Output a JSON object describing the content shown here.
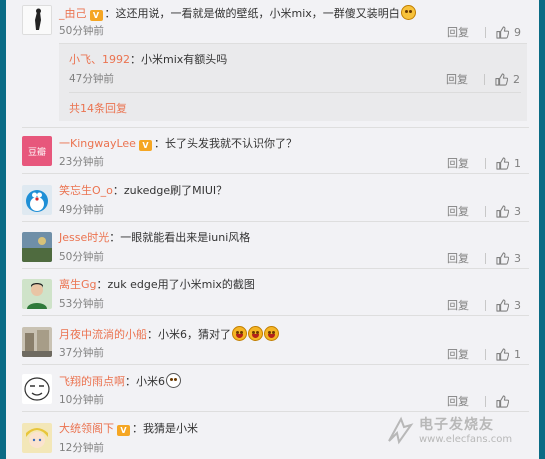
{
  "ui": {
    "reply_label": "回复",
    "accent_color": "#eb7350",
    "link_color": "#eb7350"
  },
  "comments": [
    {
      "username": "_由己",
      "vip": true,
      "text": "：这还用说，一看就是做的壁纸，小米mix，一群傻又装明白",
      "emoji": "smile",
      "time": "50分钟前",
      "likes": "9",
      "avatar": "silhouette-figure",
      "replies": {
        "text_user": "小飞、1992",
        "text": "：小米mix有额头吗",
        "time": "47分钟前",
        "likes": "2",
        "total": "共14条回复"
      }
    },
    {
      "username": "一KingwayLee",
      "vip": true,
      "text": "：长了头发我就不认识你了？",
      "time": "23分钟前",
      "likes": "1",
      "avatar": "pink-logo"
    },
    {
      "username": "笑忘生O_o",
      "vip": false,
      "text": "：zukedge刷了MIUI？",
      "time": "49分钟前",
      "likes": "3",
      "avatar": "doraemon"
    },
    {
      "username": "Jesse时光",
      "vip": false,
      "text": "：一眼就能看出来是iuni风格",
      "time": "50分钟前",
      "likes": "3",
      "avatar": "landscape"
    },
    {
      "username": "离生Gg",
      "vip": false,
      "text": "：zuk edge用了小米mix的截图",
      "time": "53分钟前",
      "likes": "3",
      "avatar": "person-green"
    },
    {
      "username": "月夜中流淌的小船",
      "vip": false,
      "text": "：小米6，猜对了",
      "emoji": "laugh x3",
      "time": "37分钟前",
      "likes": "1",
      "avatar": "street-scene"
    },
    {
      "username": "飞翔的雨点啊",
      "vip": false,
      "text": "：小米6",
      "emoji": "dog",
      "time": "10分钟前",
      "likes": "",
      "avatar": "cartoon-face"
    },
    {
      "username": "大统领阁下",
      "vip": true,
      "text": "：我猜是小米",
      "time": "12分钟前",
      "likes": "",
      "avatar": "anime-girl"
    }
  ],
  "watermark": {
    "cn": "电子发烧友",
    "en": "www.elecfans.com"
  }
}
